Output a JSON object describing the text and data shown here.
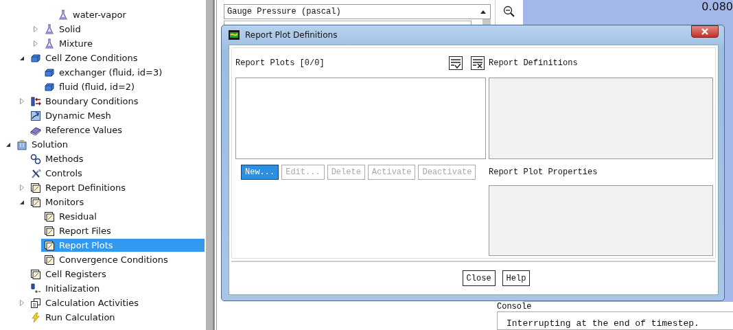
{
  "tree": {
    "items": [
      {
        "children": [
          {
            "children": [
              {
                "children": [
                  {
                    "label": "water-vapor",
                    "kind": "flask",
                    "selected": false
                  }
                ]
              },
              {
                "label": "Solid",
                "kind": "flask",
                "expanded": false,
                "selected": false
              },
              {
                "label": "Mixture",
                "kind": "flask",
                "expanded": false,
                "selected": false
              }
            ]
          },
          {
            "label": "Cell Zone Conditions",
            "kind": "cube",
            "expanded": true,
            "selected": false,
            "children": [
              {
                "label": "exchanger (fluid, id=3)",
                "kind": "cube",
                "selected": false
              },
              {
                "label": "fluid (fluid, id=2)",
                "kind": "cube",
                "selected": false
              }
            ]
          },
          {
            "label": "Boundary Conditions",
            "kind": "boundary",
            "expanded": false,
            "selected": false
          },
          {
            "label": "Dynamic Mesh",
            "kind": "mesh",
            "selected": false
          },
          {
            "label": "Reference Values",
            "kind": "book",
            "selected": false
          }
        ]
      },
      {
        "label": "Solution",
        "kind": "building",
        "expanded": true,
        "selected": false,
        "children": [
          {
            "label": "Methods",
            "kind": "gears",
            "selected": false
          },
          {
            "label": "Controls",
            "kind": "tools",
            "selected": false
          },
          {
            "label": "Report Definitions",
            "kind": "monitor",
            "expanded": false,
            "selected": false
          },
          {
            "label": "Monitors",
            "kind": "monitor",
            "expanded": true,
            "selected": false,
            "children": [
              {
                "label": "Residual",
                "kind": "monitor",
                "selected": false
              },
              {
                "label": "Report Files",
                "kind": "monitor",
                "selected": false
              },
              {
                "label": "Report Plots",
                "kind": "monitor",
                "selected": true
              },
              {
                "label": "Convergence Conditions",
                "kind": "monitor",
                "selected": false
              }
            ]
          },
          {
            "label": "Cell Registers",
            "kind": "monitor",
            "selected": false
          },
          {
            "label": "Initialization",
            "kind": "init",
            "selected": false
          },
          {
            "label": "Calculation Activities",
            "kind": "activities",
            "expanded": false,
            "selected": false
          },
          {
            "label": "Run Calculation",
            "kind": "bolt",
            "selected": false
          }
        ]
      }
    ]
  },
  "middle_panel": {
    "list_item": "Gauge Pressure (pascal)"
  },
  "graph": {
    "axis_label": "0.080"
  },
  "console": {
    "label": "Console",
    "text": "Interrupting at the end of timestep."
  },
  "dialog": {
    "title": "Report Plot Definitions",
    "list_label": "Report Plots [0/0]",
    "buttons": [
      {
        "label": "New...",
        "highlighted": true,
        "disabled": false
      },
      {
        "label": "Edit...",
        "highlighted": false,
        "disabled": true
      },
      {
        "label": "Delete",
        "highlighted": false,
        "disabled": true
      },
      {
        "label": "Activate",
        "highlighted": false,
        "disabled": true
      },
      {
        "label": "Deactivate",
        "highlighted": false,
        "disabled": true
      }
    ],
    "definitions_label": "Report Definitions",
    "properties_label": "Report Plot Properties",
    "footer_buttons": [
      "Close",
      "Help"
    ]
  }
}
